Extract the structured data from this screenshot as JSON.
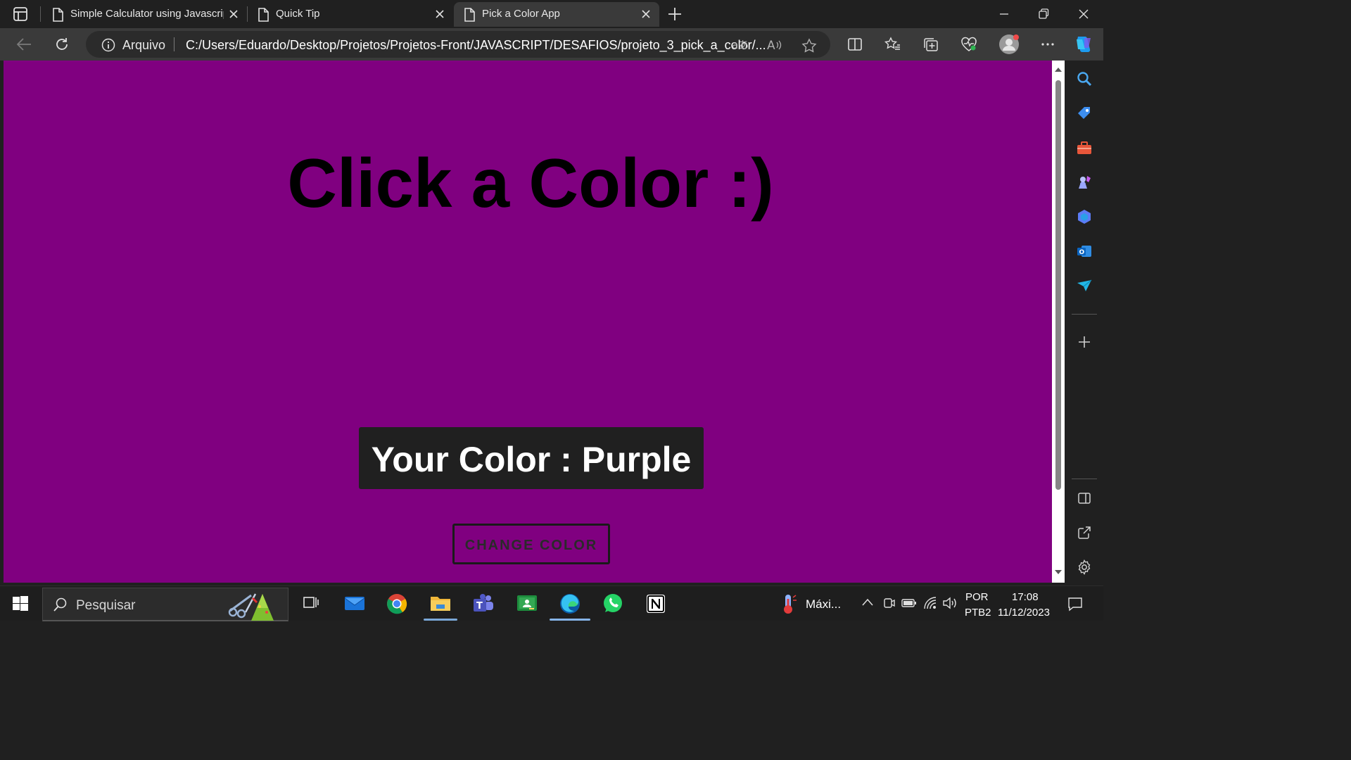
{
  "browser": {
    "tabs": [
      {
        "title": "Simple Calculator using Javascrip",
        "active": false
      },
      {
        "title": "Quick Tip",
        "active": false
      },
      {
        "title": "Pick a Color App",
        "active": true
      }
    ],
    "address": {
      "security_label": "Arquivo",
      "url": "C:/Users/Eduardo/Desktop/Projetos/Projetos-Front/JAVASCRIPT/DESAFIOS/projeto_3_pick_a_color/..."
    }
  },
  "page": {
    "title": "Click a Color :)",
    "color_display": "Your Color : Purple",
    "button_label": "CHANGE COLOR",
    "background_color": "#800080"
  },
  "taskbar": {
    "search_placeholder": "Pesquisar",
    "weather_label": "Máxi...",
    "language_top": "POR",
    "language_bottom": "PTB2",
    "time": "17:08",
    "date": "11/12/2023"
  },
  "colors": {
    "accent": "#800080",
    "chrome_dark": "#202020",
    "toolbar": "#3a3a3a"
  }
}
